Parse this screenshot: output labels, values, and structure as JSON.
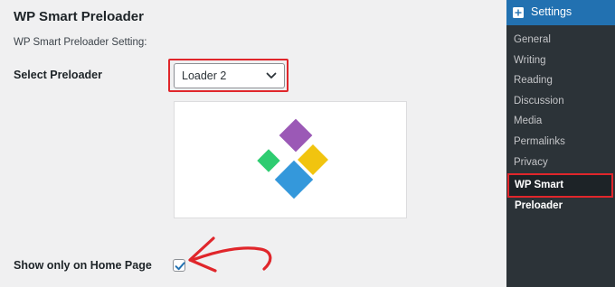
{
  "page": {
    "title": "WP Smart Preloader",
    "section_label": "WP Smart Preloader Setting:"
  },
  "preloader": {
    "label": "Select Preloader",
    "selected": "Loader 2",
    "preview_colors": [
      "#9b59b6",
      "#2ecc71",
      "#f1c40f",
      "#3498db"
    ]
  },
  "home_page": {
    "label": "Show only on Home Page",
    "checked": true
  },
  "menu": {
    "header": "Settings",
    "items": [
      {
        "label": "General"
      },
      {
        "label": "Writing"
      },
      {
        "label": "Reading"
      },
      {
        "label": "Discussion"
      },
      {
        "label": "Media"
      },
      {
        "label": "Permalinks"
      },
      {
        "label": "Privacy"
      },
      {
        "label": "WP Smart Preloader",
        "current": true
      }
    ]
  },
  "colors": {
    "accent": "#2271b1",
    "highlight": "#e0262b",
    "menu_bg": "#2c3338"
  }
}
